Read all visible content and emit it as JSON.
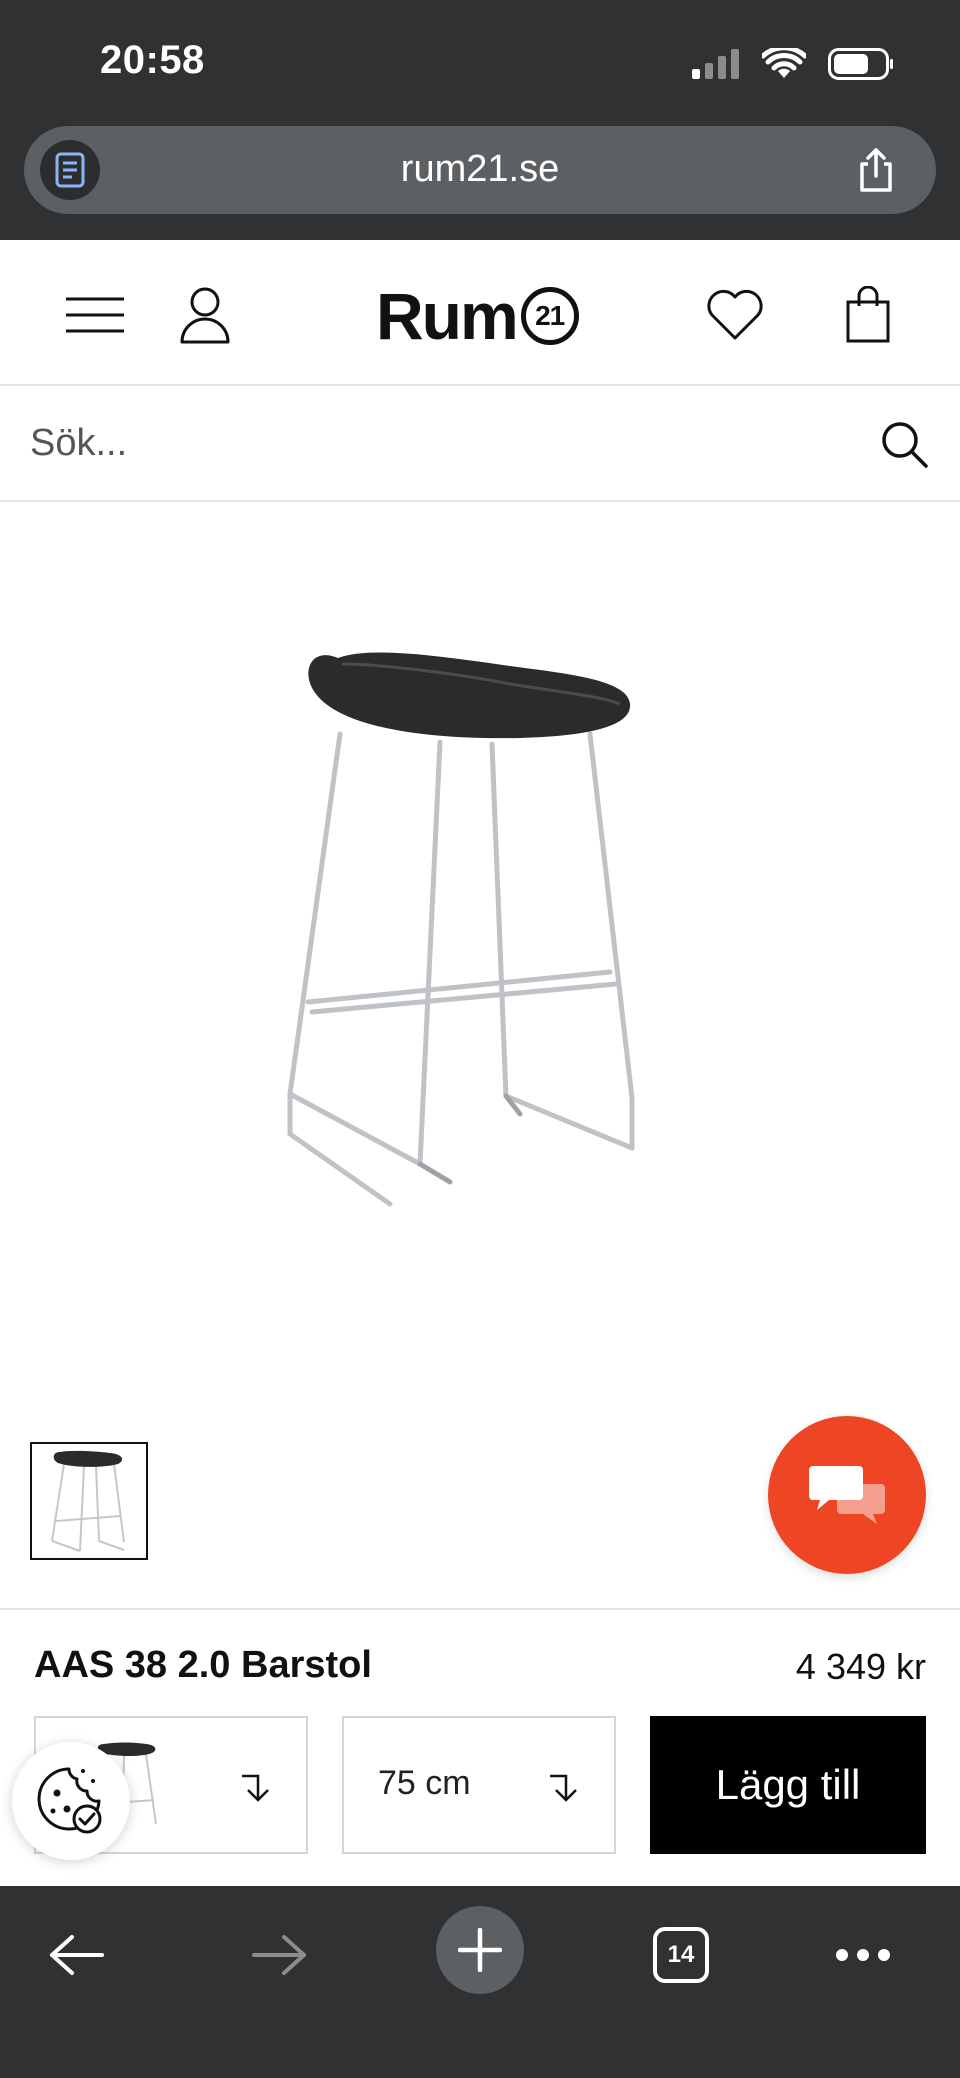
{
  "status_bar": {
    "time": "20:58"
  },
  "browser": {
    "url": "rum21.se",
    "tabs_count": "14"
  },
  "header": {
    "logo_text": "Rum",
    "logo_badge": "21"
  },
  "search": {
    "placeholder": "Sök..."
  },
  "product": {
    "name": "AAS 38 2.0 Barstol",
    "price": "4 349 kr",
    "size_label": "75 cm",
    "add_to_cart_label": "Lägg till"
  },
  "colors": {
    "chat_accent": "#ee4524",
    "browser_chrome": "#2f3133",
    "add_button": "#000000"
  },
  "icons": {
    "menu": "hamburger-menu-icon",
    "account": "user-icon",
    "wishlist": "heart-icon",
    "cart": "shopping-bag-icon",
    "search": "search-icon",
    "chat": "chat-bubbles-icon",
    "cookie": "cookie-icon",
    "back": "arrow-left-icon",
    "forward": "arrow-right-icon",
    "new_tab": "plus-icon",
    "more": "more-dots-icon"
  }
}
